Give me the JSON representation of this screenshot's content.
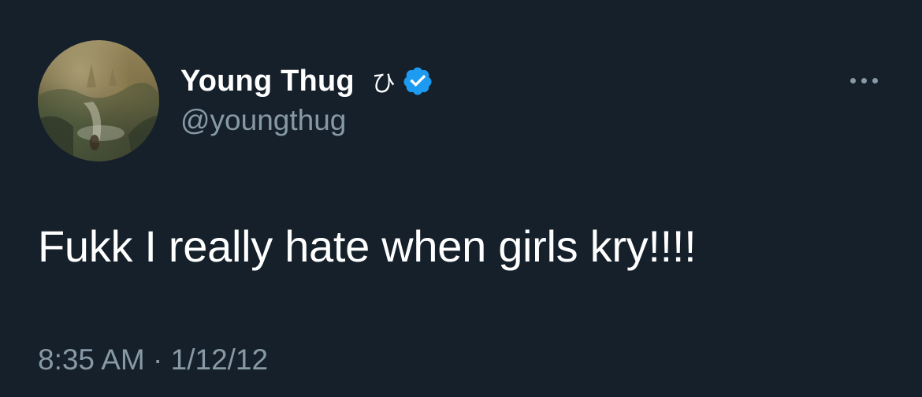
{
  "author": {
    "display_name": "Young Thug",
    "name_emoji": "ひ",
    "handle": "@youngthug",
    "verified": true
  },
  "tweet": {
    "text": "Fukk I really hate when girls kry!!!!",
    "timestamp": "8:35 AM · 1/12/12"
  },
  "icons": {
    "verified": "verified-badge-icon",
    "more": "more-options-icon"
  },
  "colors": {
    "background": "#15202b",
    "primary_text": "#ffffff",
    "secondary_text": "#8899a6",
    "verified_blue": "#1d9bf0"
  }
}
